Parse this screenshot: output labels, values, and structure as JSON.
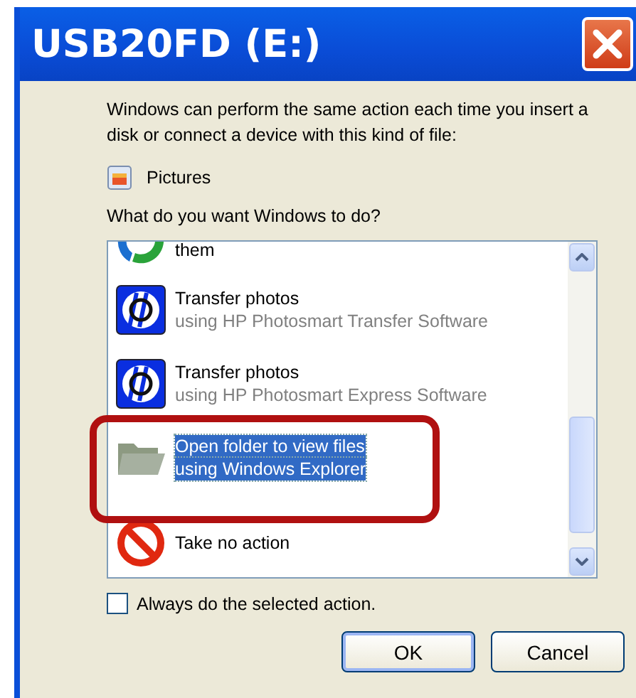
{
  "window": {
    "title": "USB20FD (E:)"
  },
  "intro": "Windows can perform the same action each time you insert a disk or connect a device with this kind of file:",
  "content_type": "Pictures",
  "question": "What do you want Windows to do?",
  "actions": [
    {
      "kind": "partial",
      "title": "them",
      "selected": false
    },
    {
      "kind": "hp",
      "title": "Transfer photos",
      "subtitle": "using HP Photosmart Transfer Software",
      "selected": false
    },
    {
      "kind": "hp",
      "title": "Transfer photos",
      "subtitle": "using HP Photosmart Express Software",
      "selected": false
    },
    {
      "kind": "folder",
      "title": "Open folder to view files",
      "subtitle": "using Windows Explorer",
      "selected": true
    },
    {
      "kind": "none",
      "title": "Take no action",
      "selected": false
    }
  ],
  "always_checkbox": {
    "label": "Always do the selected action.",
    "checked": false
  },
  "buttons": [
    "OK",
    "Cancel"
  ]
}
